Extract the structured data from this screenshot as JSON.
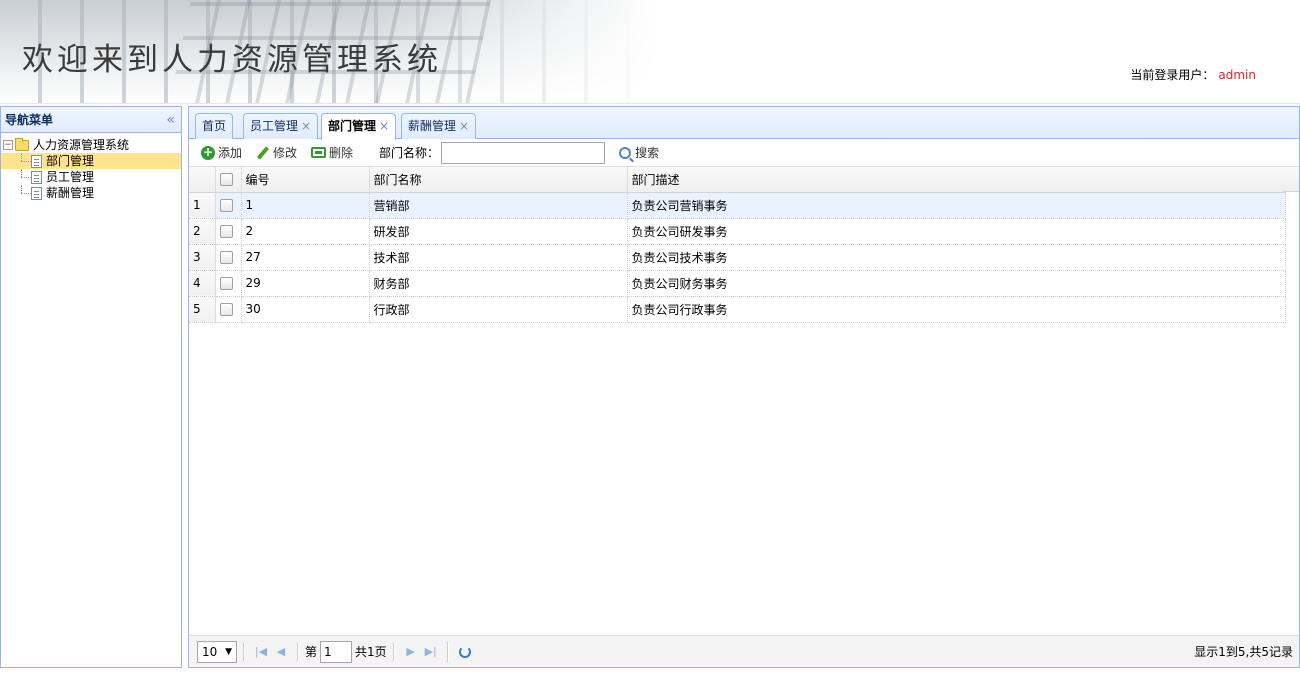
{
  "header": {
    "title": "欢迎来到人力资源管理系统",
    "login_label": "当前登录用户：",
    "login_user": "admin"
  },
  "nav": {
    "title": "导航菜单",
    "collapse_glyph": "«",
    "root_label": "人力资源管理系统",
    "items": [
      {
        "label": "部门管理",
        "selected": true
      },
      {
        "label": "员工管理",
        "selected": false
      },
      {
        "label": "薪酬管理",
        "selected": false
      }
    ]
  },
  "tabs": [
    {
      "label": "首页",
      "closable": false,
      "active": false
    },
    {
      "label": "员工管理",
      "closable": true,
      "active": false
    },
    {
      "label": "部门管理",
      "closable": true,
      "active": true
    },
    {
      "label": "薪酬管理",
      "closable": true,
      "active": false
    }
  ],
  "tab_close_glyph": "×",
  "toolbar": {
    "add_label": "添加",
    "edit_label": "修改",
    "delete_label": "删除",
    "search_label": "部门名称：",
    "search_value": "",
    "search_button_label": "搜索"
  },
  "grid": {
    "columns": [
      "编号",
      "部门名称",
      "部门描述"
    ],
    "rows": [
      {
        "rownum": "1",
        "id": "1",
        "name": "营销部",
        "desc": "负责公司营销事务",
        "selected": true
      },
      {
        "rownum": "2",
        "id": "2",
        "name": "研发部",
        "desc": "负责公司研发事务",
        "selected": false
      },
      {
        "rownum": "3",
        "id": "27",
        "name": "技术部",
        "desc": "负责公司技术事务",
        "selected": false
      },
      {
        "rownum": "4",
        "id": "29",
        "name": "财务部",
        "desc": "负责公司财务事务",
        "selected": false
      },
      {
        "rownum": "5",
        "id": "30",
        "name": "行政部",
        "desc": "负责公司行政事务",
        "selected": false
      }
    ]
  },
  "pager": {
    "page_size": "10",
    "page_prefix": "第",
    "page_value": "1",
    "page_suffix": "共1页",
    "info": "显示1到5,共5记录"
  },
  "colors": {
    "border": "#95b8e7",
    "selected_tree": "#ffe48d",
    "selected_row": "#eaf2ff",
    "user_name": "#e3232b"
  }
}
